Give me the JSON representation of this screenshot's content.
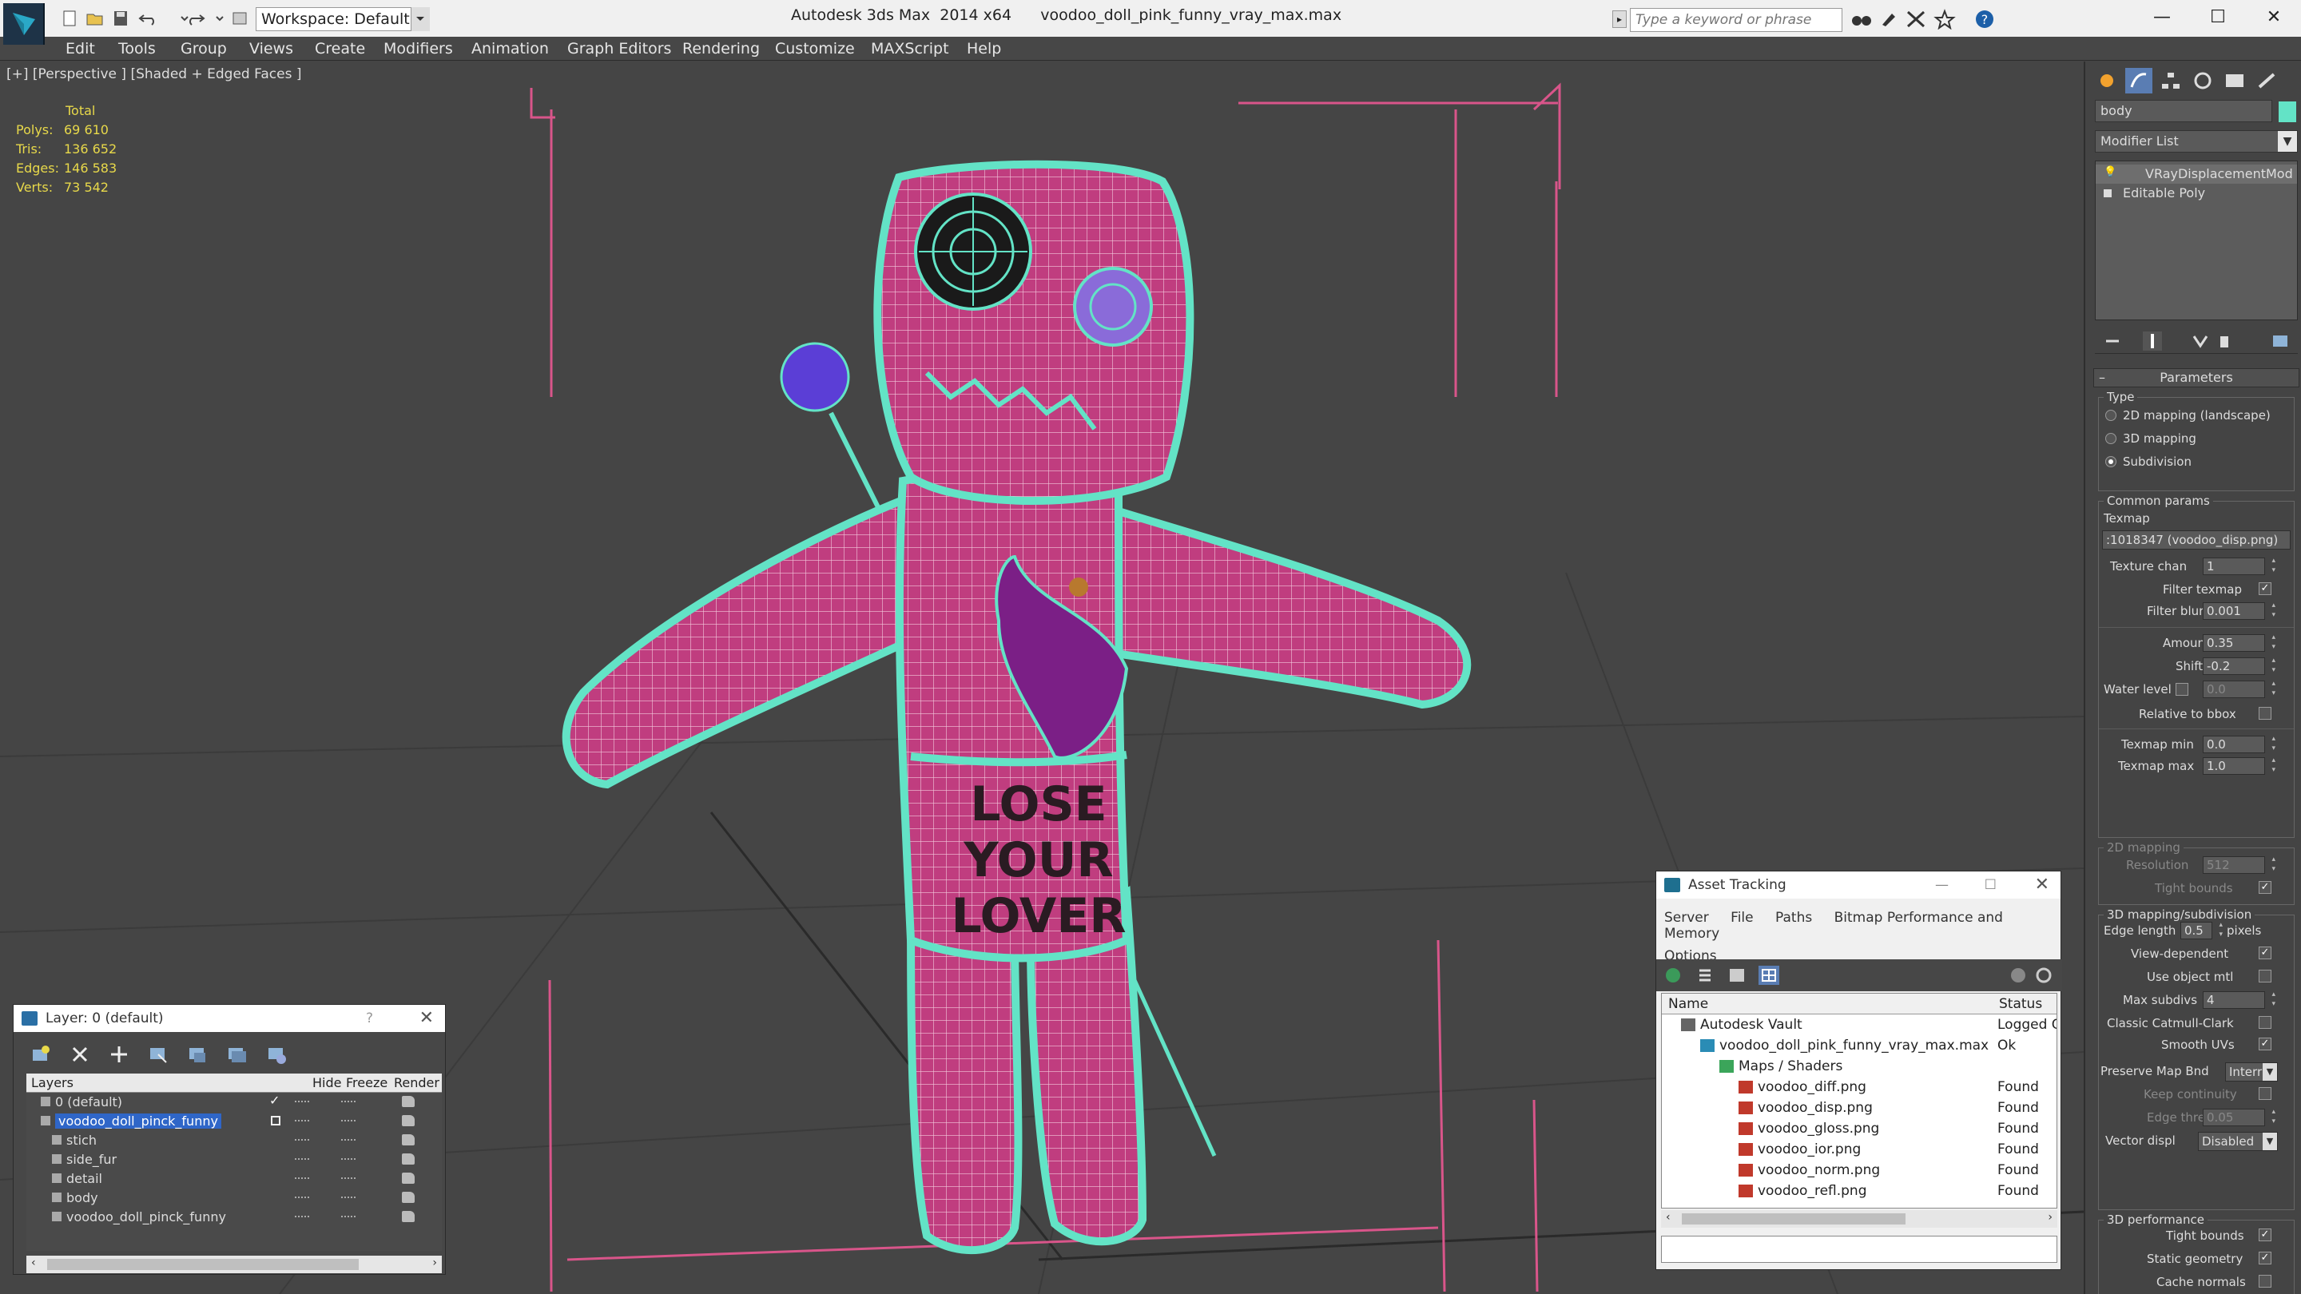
{
  "app": {
    "title": "Autodesk 3ds Max  2014 x64      voodoo_doll_pink_funny_vray_max.max",
    "workspace": "Workspace: Default",
    "search_placeholder": "Type a keyword or phrase"
  },
  "menu": [
    "Edit",
    "Tools",
    "Group",
    "Views",
    "Create",
    "Modifiers",
    "Animation",
    "Graph Editors",
    "Rendering",
    "Customize",
    "MAXScript",
    "Help"
  ],
  "viewport": {
    "label": "[+] [Perspective ] [Shaded + Edged Faces ]",
    "stats": {
      "total_label": "Total",
      "rows": [
        {
          "label": "Polys:",
          "value": "69 610"
        },
        {
          "label": "Tris:",
          "value": "136 652"
        },
        {
          "label": "Edges:",
          "value": "146 583"
        },
        {
          "label": "Verts:",
          "value": "73 542"
        }
      ]
    },
    "doll_text": [
      "LOSE",
      "YOUR",
      "LOVER"
    ]
  },
  "layers": {
    "title": "Layer: 0 (default)",
    "help": "?",
    "columns": [
      "Layers",
      "Hide",
      "Freeze",
      "Render"
    ],
    "rows": [
      {
        "name": "0 (default)",
        "indent": 0,
        "selected": false,
        "current": true
      },
      {
        "name": "voodoo_doll_pinck_funny",
        "indent": 0,
        "selected": true,
        "current": false
      },
      {
        "name": "stich",
        "indent": 1,
        "selected": false,
        "current": false
      },
      {
        "name": "side_fur",
        "indent": 1,
        "selected": false,
        "current": false
      },
      {
        "name": "detail",
        "indent": 1,
        "selected": false,
        "current": false
      },
      {
        "name": "body",
        "indent": 1,
        "selected": false,
        "current": false
      },
      {
        "name": "voodoo_doll_pinck_funny",
        "indent": 1,
        "selected": false,
        "current": false
      }
    ]
  },
  "assets": {
    "title": "Asset Tracking",
    "menu": [
      "Server",
      "File",
      "Paths",
      "Bitmap Performance and Memory",
      "Options"
    ],
    "columns": [
      "Name",
      "Status"
    ],
    "rows": [
      {
        "name": "Autodesk Vault",
        "status": "Logged O",
        "indent": 0,
        "icon": "vault-icon"
      },
      {
        "name": "voodoo_doll_pink_funny_vray_max.max",
        "status": "Ok",
        "indent": 1,
        "icon": "max-file-icon"
      },
      {
        "name": "Maps / Shaders",
        "status": "",
        "indent": 2,
        "icon": "maps-icon"
      },
      {
        "name": "voodoo_diff.png",
        "status": "Found",
        "indent": 3,
        "icon": "png-icon"
      },
      {
        "name": "voodoo_disp.png",
        "status": "Found",
        "indent": 3,
        "icon": "png-icon"
      },
      {
        "name": "voodoo_gloss.png",
        "status": "Found",
        "indent": 3,
        "icon": "png-icon"
      },
      {
        "name": "voodoo_ior.png",
        "status": "Found",
        "indent": 3,
        "icon": "png-icon"
      },
      {
        "name": "voodoo_norm.png",
        "status": "Found",
        "indent": 3,
        "icon": "png-icon"
      },
      {
        "name": "voodoo_refl.png",
        "status": "Found",
        "indent": 3,
        "icon": "png-icon"
      }
    ]
  },
  "command_panel": {
    "object_name": "body",
    "object_color": "#63e3c6",
    "modifier_list": "Modifier List",
    "stack": [
      "VRayDisplacementMod",
      "Editable Poly"
    ],
    "params_title": "Parameters",
    "type_group": {
      "title": "Type",
      "options": [
        {
          "label": "2D mapping (landscape)",
          "on": false
        },
        {
          "label": "3D mapping",
          "on": false
        },
        {
          "label": "Subdivision",
          "on": true
        }
      ]
    },
    "common": {
      "title": "Common params",
      "texmap_label": "Texmap",
      "texmap_value": ":1018347 (voodoo_disp.png)",
      "texture_chan_label": "Texture chan",
      "texture_chan": "1",
      "filter_texmap_label": "Filter texmap",
      "filter_texmap": true,
      "filter_blur_label": "Filter blur",
      "filter_blur": "0.001",
      "amount_label": "Amount",
      "amount": "0.35",
      "shift_label": "Shift",
      "shift": "-0.2",
      "water_level_label": "Water level",
      "water_level": "0.0",
      "relative_bbox_label": "Relative to bbox",
      "texmap_min_label": "Texmap min",
      "texmap_min": "0.0",
      "texmap_max_label": "Texmap max",
      "texmap_max": "1.0"
    },
    "mapping2d": {
      "title": "2D mapping",
      "resolution_label": "Resolution",
      "resolution": "512",
      "tight_bounds_label": "Tight bounds"
    },
    "mapping3d": {
      "title": "3D mapping/subdivision",
      "edge_length_label": "Edge length",
      "edge_length": "0.5",
      "pixels_label": "pixels",
      "view_dependent_label": "View-dependent",
      "use_object_mtl_label": "Use object mtl",
      "max_subdivs_label": "Max subdivs",
      "max_subdivs": "4",
      "catmull_label": "Classic Catmull-Clark",
      "smooth_uvs_label": "Smooth UVs",
      "preserve_label": "Preserve Map Bnd",
      "preserve_value": "Interr",
      "keep_continuity_label": "Keep continuity",
      "edge_thresh_label": "Edge thresh",
      "edge_thresh": "0.05",
      "vector_displ_label": "Vector displ",
      "vector_displ_value": "Disabled"
    },
    "perf": {
      "title": "3D performance",
      "tight_bounds_label": "Tight bounds",
      "static_geometry_label": "Static geometry",
      "cache_normals_label": "Cache normals"
    }
  }
}
